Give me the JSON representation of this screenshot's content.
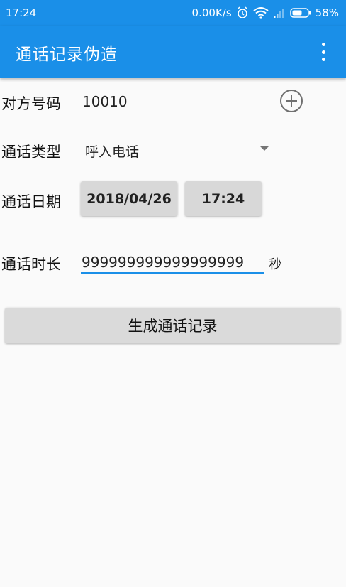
{
  "status_bar": {
    "time": "17:24",
    "net_speed": "0.00K/s",
    "battery": "58%"
  },
  "toolbar": {
    "title": "通话记录伪造",
    "more_icon": "more-vert-icon"
  },
  "form": {
    "number_label": "对方号码",
    "number_value": "10010",
    "type_label": "通话类型",
    "type_value": "呼入电话",
    "date_label": "通话日期",
    "date_value": "2018/04/26",
    "time_value": "17:24",
    "duration_label": "通话时长",
    "duration_value": "999999999999999999",
    "duration_unit": "秒"
  },
  "generate_button": "生成通话记录",
  "colors": {
    "accent": "#1a8fe8",
    "button_bg": "#d8d8d8"
  }
}
